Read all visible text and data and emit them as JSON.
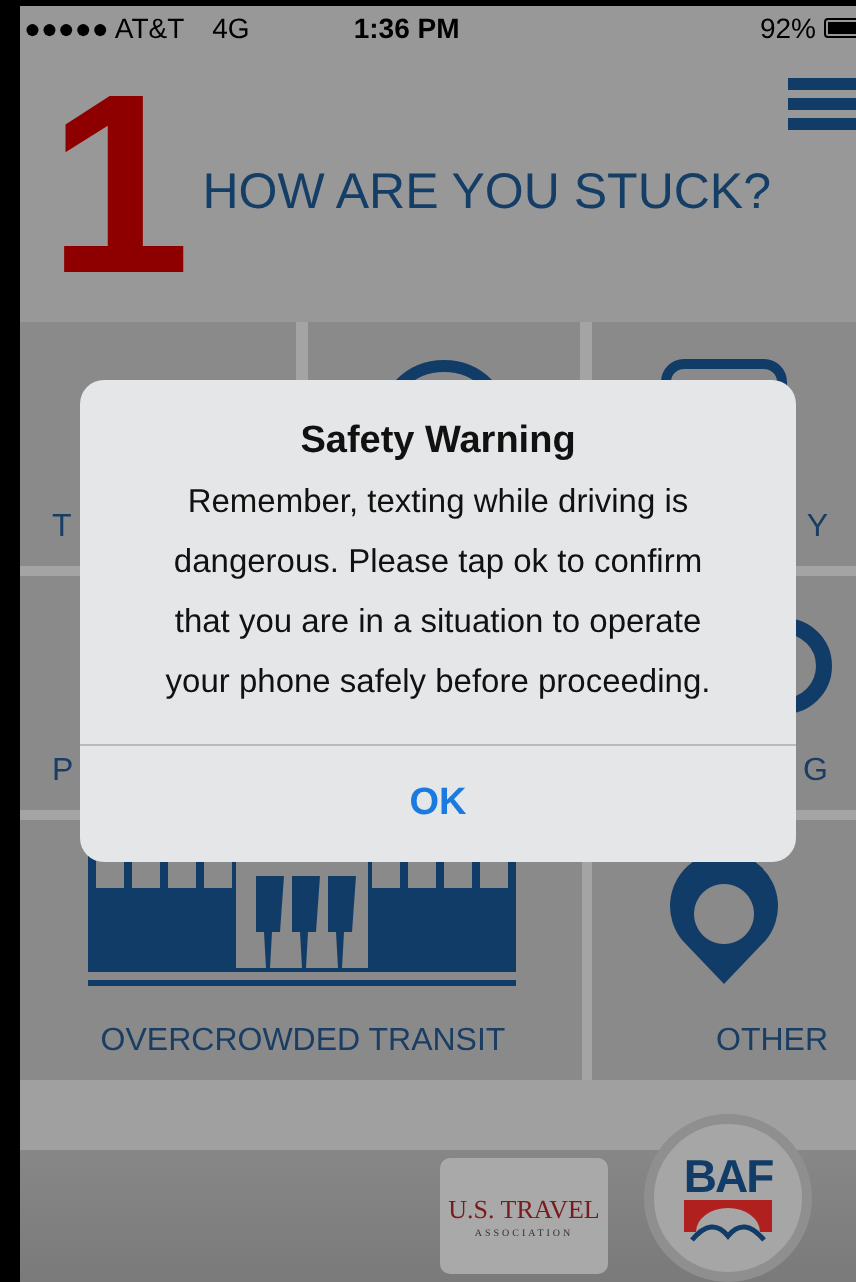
{
  "status_bar": {
    "carrier": "●●●●● AT&T",
    "network": "4G",
    "time": "1:36 PM",
    "battery": "92%"
  },
  "header": {
    "step": "1",
    "title": "HOW ARE YOU STUCK?"
  },
  "tile_rows": [
    {
      "tiles": [
        {
          "kind": "plain",
          "label": "T"
        },
        {
          "kind": "circle"
        },
        {
          "kind": "frame",
          "label": "Y"
        }
      ]
    },
    {
      "tiles": [
        {
          "kind": "plain",
          "label": "P"
        },
        {
          "kind": "ring",
          "label": "G"
        }
      ]
    },
    {
      "tiles": [
        {
          "kind": "transit",
          "label": "OVERCROWDED TRANSIT"
        },
        {
          "kind": "pin",
          "label": "OTHER"
        }
      ]
    }
  ],
  "footer": {
    "partner": "U.S. TRAVEL",
    "partner_sub": "ASSOCIATION",
    "badge": "BAF"
  },
  "dialog": {
    "title": "Safety Warning",
    "message": "Remember, texting while driving is dangerous. Please tap ok to confirm that you are in a situation to operate your phone safely before proceeding.",
    "button": "OK"
  }
}
